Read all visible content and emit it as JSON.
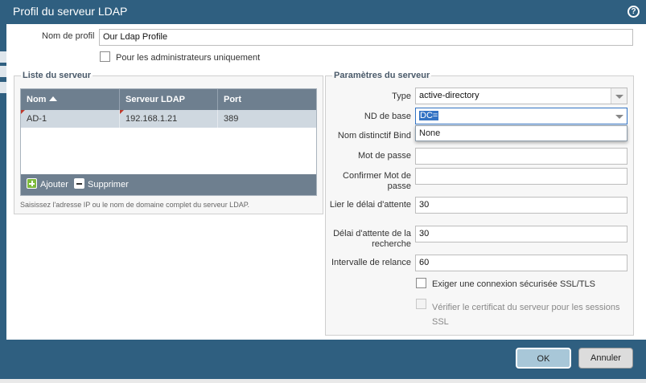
{
  "window": {
    "title": "Profil du serveur LDAP",
    "help_icon": "?"
  },
  "profile": {
    "name_label": "Nom de profil",
    "name_value": "Our Ldap Profile",
    "admin_only_label": "Pour les administrateurs uniquement",
    "admin_only_checked": false
  },
  "server_list": {
    "legend": "Liste du serveur",
    "columns": [
      "Nom",
      "Serveur LDAP",
      "Port"
    ],
    "rows": [
      {
        "name": "AD-1",
        "server": "192.168.1.21",
        "port": "389"
      }
    ],
    "add_label": "Ajouter",
    "delete_label": "Supprimer",
    "hint": "Saisissez l'adresse IP ou le nom de domaine complet du serveur LDAP."
  },
  "settings": {
    "legend": "Paramètres du serveur",
    "type_label": "Type",
    "type_value": "active-directory",
    "base_dn_label": "ND de base",
    "base_dn_value": "DC=",
    "bind_dn_label": "Nom distinctif Bind",
    "bind_dn_dropdown_option": "None",
    "password_label": "Mot de passe",
    "confirm_password_label": "Confirmer Mot de passe",
    "bind_timeout_label": "Lier le délai d'attente",
    "bind_timeout_value": "30",
    "search_timeout_label": "Délai d'attente de la recherche",
    "search_timeout_value": "30",
    "retry_interval_label": "Intervalle de relance",
    "retry_interval_value": "60",
    "require_ssl_label": "Exiger une connexion sécurisée SSL/TLS",
    "require_ssl_checked": false,
    "verify_cert_label": "Vérifier le certificat du serveur pour les sessions SSL",
    "verify_cert_checked": false,
    "verify_cert_disabled": true
  },
  "buttons": {
    "ok": "OK",
    "cancel": "Annuler"
  },
  "colors": {
    "titlebar": "#2f5f80",
    "grid_header": "#6e7f8f",
    "selected_row": "#cfd8e0",
    "ok_button": "#a8c7d8"
  }
}
